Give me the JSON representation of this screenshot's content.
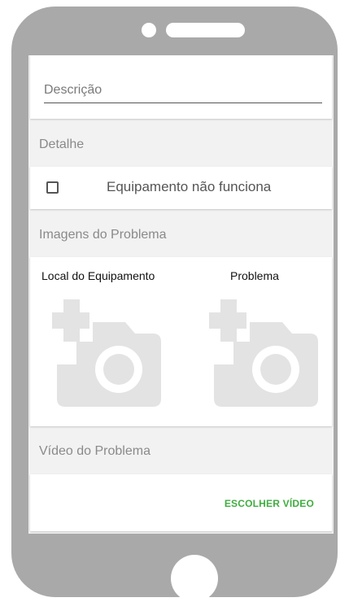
{
  "form": {
    "description_placeholder": "Descrição",
    "detail_title": "Detalhe",
    "equipment_checkbox_label": "Equipamento não funciona",
    "equipment_checked": false,
    "images_title": "Imagens do Problema",
    "image_slots": [
      {
        "label": "Local do Equipamento",
        "icon": "add-photo-icon"
      },
      {
        "label": "Problema",
        "icon": "add-photo-icon"
      }
    ],
    "video_title": "Vídeo do Problema",
    "choose_video_label": "ESCOLHER VÍDEO"
  },
  "colors": {
    "phone_frame": "#a9a9a9",
    "accent_green": "#3fad3f",
    "icon_gray": "#e3e3e3"
  }
}
